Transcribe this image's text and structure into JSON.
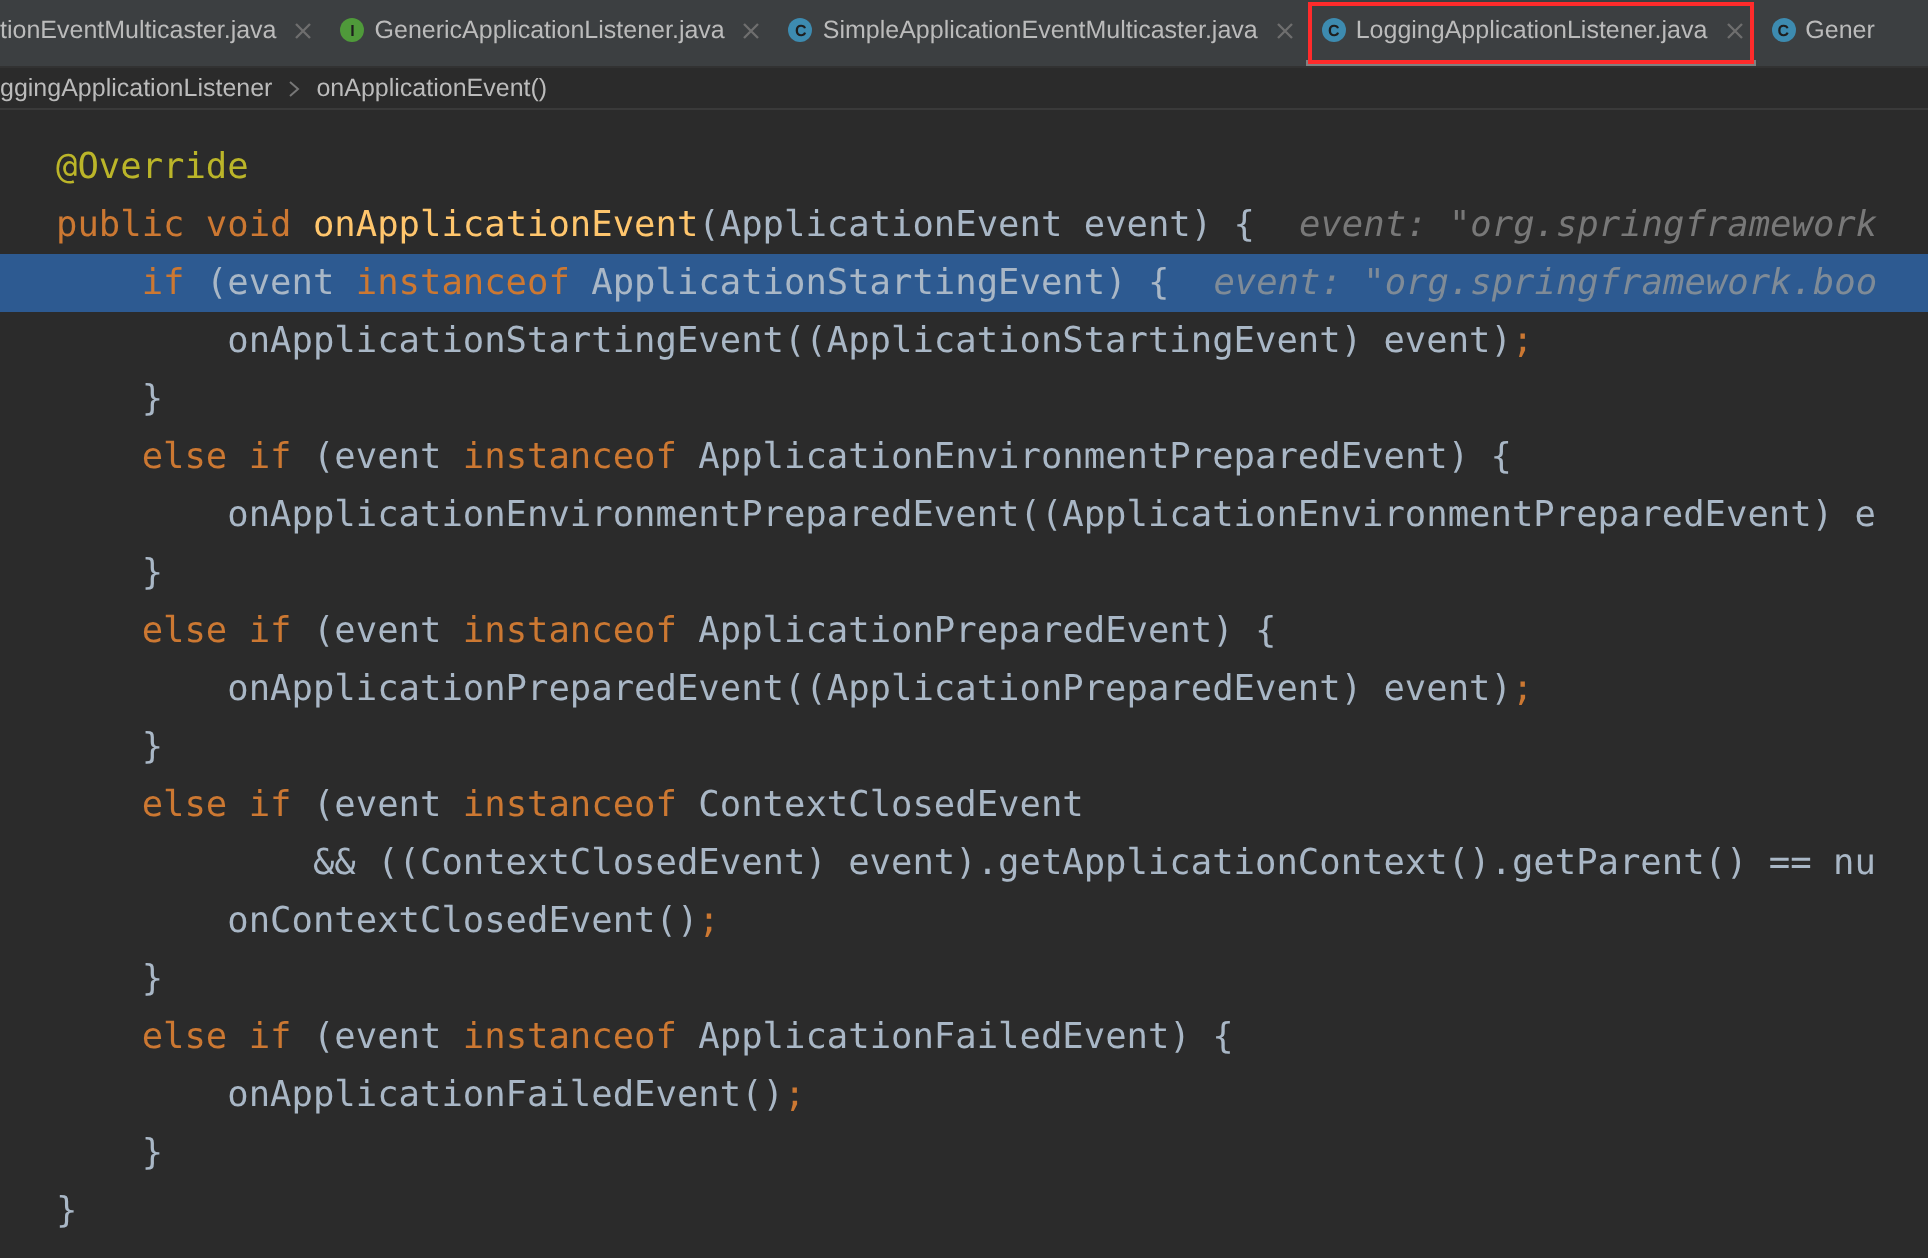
{
  "tabs": [
    {
      "label": "tionEventMulticaster.java",
      "selected": false,
      "marked": false
    },
    {
      "label": "GenericApplicationListener.java",
      "icon_letter": "I",
      "color": "#4f9a3a",
      "selected": false,
      "marked": false
    },
    {
      "label": "SimpleApplicationEventMulticaster.java",
      "icon_letter": "C",
      "color": "#3d8bb0",
      "selected": false,
      "marked": false
    },
    {
      "label": "LoggingApplicationListener.java",
      "icon_letter": "C",
      "color": "#3d8bb0",
      "selected": true,
      "marked": true
    },
    {
      "label": "Gener",
      "icon_letter": "C",
      "color": "#3d8bb0",
      "selected": false,
      "marked": false
    }
  ],
  "breadcrumb": [
    "ggingApplicationListener",
    "onApplicationEvent()"
  ],
  "code_lines": [
    {
      "selected": false,
      "tokens": [
        {
          "kind": "annotation",
          "text": "@Override"
        }
      ]
    },
    {
      "selected": false,
      "tokens": [
        {
          "kind": "keyword",
          "text": "public void "
        },
        {
          "kind": "method",
          "text": "onApplicationEvent"
        },
        {
          "kind": "plain",
          "text": "(ApplicationEvent event) {"
        }
      ],
      "hint": "event: \"org.springframework"
    },
    {
      "selected": true,
      "tokens": [
        {
          "kind": "keyword",
          "text": "    if "
        },
        {
          "kind": "plain",
          "text": "(event "
        },
        {
          "kind": "keyword",
          "text": "instanceof "
        },
        {
          "kind": "plain",
          "text": "ApplicationStartingEvent) {"
        }
      ],
      "hint": "event: \"org.springframework.boo"
    },
    {
      "selected": false,
      "tokens": [
        {
          "kind": "plain",
          "text": "        onApplicationStartingEvent((ApplicationStartingEvent) event)"
        },
        {
          "kind": "keyword",
          "text": ";"
        }
      ]
    },
    {
      "selected": false,
      "tokens": [
        {
          "kind": "plain",
          "text": "    }"
        }
      ]
    },
    {
      "selected": false,
      "tokens": [
        {
          "kind": "keyword",
          "text": "    else if "
        },
        {
          "kind": "plain",
          "text": "(event "
        },
        {
          "kind": "keyword",
          "text": "instanceof "
        },
        {
          "kind": "plain",
          "text": "ApplicationEnvironmentPreparedEvent) {"
        }
      ]
    },
    {
      "selected": false,
      "tokens": [
        {
          "kind": "plain",
          "text": "        onApplicationEnvironmentPreparedEvent((ApplicationEnvironmentPreparedEvent) e"
        }
      ]
    },
    {
      "selected": false,
      "tokens": [
        {
          "kind": "plain",
          "text": "    }"
        }
      ]
    },
    {
      "selected": false,
      "tokens": [
        {
          "kind": "keyword",
          "text": "    else if "
        },
        {
          "kind": "plain",
          "text": "(event "
        },
        {
          "kind": "keyword",
          "text": "instanceof "
        },
        {
          "kind": "plain",
          "text": "ApplicationPreparedEvent) {"
        }
      ]
    },
    {
      "selected": false,
      "tokens": [
        {
          "kind": "plain",
          "text": "        onApplicationPreparedEvent((ApplicationPreparedEvent) event)"
        },
        {
          "kind": "keyword",
          "text": ";"
        }
      ]
    },
    {
      "selected": false,
      "tokens": [
        {
          "kind": "plain",
          "text": "    }"
        }
      ]
    },
    {
      "selected": false,
      "tokens": [
        {
          "kind": "keyword",
          "text": "    else if "
        },
        {
          "kind": "plain",
          "text": "(event "
        },
        {
          "kind": "keyword",
          "text": "instanceof "
        },
        {
          "kind": "plain",
          "text": "ContextClosedEvent"
        }
      ]
    },
    {
      "selected": false,
      "tokens": [
        {
          "kind": "plain",
          "text": "            && ((ContextClosedEvent) event).getApplicationContext().getParent() == nu"
        }
      ]
    },
    {
      "selected": false,
      "tokens": [
        {
          "kind": "plain",
          "text": "        onContextClosedEvent()"
        },
        {
          "kind": "keyword",
          "text": ";"
        }
      ]
    },
    {
      "selected": false,
      "tokens": [
        {
          "kind": "plain",
          "text": "    }"
        }
      ]
    },
    {
      "selected": false,
      "tokens": [
        {
          "kind": "keyword",
          "text": "    else if "
        },
        {
          "kind": "plain",
          "text": "(event "
        },
        {
          "kind": "keyword",
          "text": "instanceof "
        },
        {
          "kind": "plain",
          "text": "ApplicationFailedEvent) {"
        }
      ]
    },
    {
      "selected": false,
      "tokens": [
        {
          "kind": "plain",
          "text": "        onApplicationFailedEvent()"
        },
        {
          "kind": "keyword",
          "text": ";"
        }
      ]
    },
    {
      "selected": false,
      "tokens": [
        {
          "kind": "plain",
          "text": "    }"
        }
      ]
    },
    {
      "selected": false,
      "tokens": [
        {
          "kind": "plain",
          "text": "}"
        }
      ]
    }
  ]
}
